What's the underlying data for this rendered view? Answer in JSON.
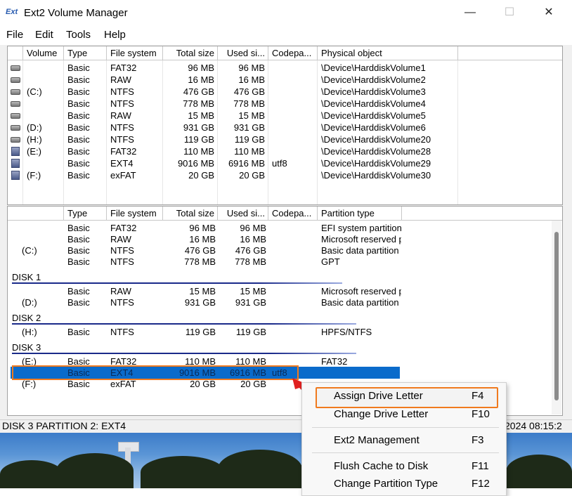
{
  "window": {
    "title": "Ext2 Volume Manager",
    "app_icon_text": "Ext",
    "controls": {
      "minimize": "—",
      "maximize": "☐",
      "close": "✕"
    }
  },
  "menubar": [
    "File",
    "Edit",
    "Tools",
    "Help"
  ],
  "volume_list": {
    "headers": [
      "Volume",
      "Type",
      "File system",
      "Total size",
      "Used si...",
      "Codepa...",
      "Physical object"
    ],
    "rows": [
      {
        "icon": "drive",
        "volume": "",
        "type": "Basic",
        "fs": "FAT32",
        "total": "96 MB",
        "used": "96 MB",
        "codepage": "",
        "physical": "\\Device\\HarddiskVolume1"
      },
      {
        "icon": "drive",
        "volume": "",
        "type": "Basic",
        "fs": "RAW",
        "total": "16 MB",
        "used": "16 MB",
        "codepage": "",
        "physical": "\\Device\\HarddiskVolume2"
      },
      {
        "icon": "drive",
        "volume": "(C:)",
        "type": "Basic",
        "fs": "NTFS",
        "total": "476 GB",
        "used": "476 GB",
        "codepage": "",
        "physical": "\\Device\\HarddiskVolume3"
      },
      {
        "icon": "drive",
        "volume": "",
        "type": "Basic",
        "fs": "NTFS",
        "total": "778 MB",
        "used": "778 MB",
        "codepage": "",
        "physical": "\\Device\\HarddiskVolume4"
      },
      {
        "icon": "drive",
        "volume": "",
        "type": "Basic",
        "fs": "RAW",
        "total": "15 MB",
        "used": "15 MB",
        "codepage": "",
        "physical": "\\Device\\HarddiskVolume5"
      },
      {
        "icon": "drive",
        "volume": "(D:)",
        "type": "Basic",
        "fs": "NTFS",
        "total": "931 GB",
        "used": "931 GB",
        "codepage": "",
        "physical": "\\Device\\HarddiskVolume6"
      },
      {
        "icon": "drive",
        "volume": "(H:)",
        "type": "Basic",
        "fs": "NTFS",
        "total": "119 GB",
        "used": "119 GB",
        "codepage": "",
        "physical": "\\Device\\HarddiskVolume20"
      },
      {
        "icon": "usb",
        "volume": "(E:)",
        "type": "Basic",
        "fs": "FAT32",
        "total": "110 MB",
        "used": "110 MB",
        "codepage": "",
        "physical": "\\Device\\HarddiskVolume28"
      },
      {
        "icon": "usb",
        "volume": "",
        "type": "Basic",
        "fs": "EXT4",
        "total": "9016 MB",
        "used": "6916 MB",
        "codepage": "utf8",
        "physical": "\\Device\\HarddiskVolume29"
      },
      {
        "icon": "usb",
        "volume": "(F:)",
        "type": "Basic",
        "fs": "exFAT",
        "total": "20 GB",
        "used": "20 GB",
        "codepage": "",
        "physical": "\\Device\\HarddiskVolume30"
      }
    ]
  },
  "disk_list": {
    "headers": [
      "",
      "Type",
      "File system",
      "Total size",
      "Used si...",
      "Codepa...",
      "Partition type"
    ],
    "groups": [
      {
        "label": "",
        "rows": [
          {
            "vol": "",
            "type": "Basic",
            "fs": "FAT32",
            "total": "96 MB",
            "used": "96 MB",
            "cp": "",
            "ptype": "EFI system partition"
          },
          {
            "vol": "",
            "type": "Basic",
            "fs": "RAW",
            "total": "16 MB",
            "used": "16 MB",
            "cp": "",
            "ptype": "Microsoft reserved p"
          },
          {
            "vol": "(C:)",
            "type": "Basic",
            "fs": "NTFS",
            "total": "476 GB",
            "used": "476 GB",
            "cp": "",
            "ptype": "Basic data partition"
          },
          {
            "vol": "",
            "type": "Basic",
            "fs": "NTFS",
            "total": "778 MB",
            "used": "778 MB",
            "cp": "",
            "ptype": "GPT"
          }
        ]
      },
      {
        "label": "DISK 1",
        "rows": [
          {
            "vol": "",
            "type": "Basic",
            "fs": "RAW",
            "total": "15 MB",
            "used": "15 MB",
            "cp": "",
            "ptype": "Microsoft reserved p"
          },
          {
            "vol": "(D:)",
            "type": "Basic",
            "fs": "NTFS",
            "total": "931 GB",
            "used": "931 GB",
            "cp": "",
            "ptype": "Basic data partition"
          }
        ]
      },
      {
        "label": "DISK 2",
        "rows": [
          {
            "vol": "(H:)",
            "type": "Basic",
            "fs": "NTFS",
            "total": "119 GB",
            "used": "119 GB",
            "cp": "",
            "ptype": "HPFS/NTFS"
          }
        ]
      },
      {
        "label": "DISK 3",
        "rows": [
          {
            "vol": "(E:)",
            "type": "Basic",
            "fs": "FAT32",
            "total": "110 MB",
            "used": "110 MB",
            "cp": "",
            "ptype": "FAT32"
          },
          {
            "vol": "",
            "type": "Basic",
            "fs": "EXT4",
            "total": "9016 MB",
            "used": "6916 MB",
            "cp": "utf8",
            "ptype": "",
            "selected": true
          },
          {
            "vol": "(F:)",
            "type": "Basic",
            "fs": "exFAT",
            "total": "20 GB",
            "used": "20 GB",
            "cp": "",
            "ptype": ""
          }
        ]
      }
    ]
  },
  "context_menu": {
    "items": [
      {
        "label": "Assign Drive Letter",
        "key": "F4",
        "highlighted": true
      },
      {
        "label": "Change Drive Letter",
        "key": "F10"
      },
      {
        "label": "Ext2 Management",
        "key": "F3"
      },
      {
        "label": "Flush Cache to Disk",
        "key": "F11"
      },
      {
        "label": "Change Partition Type",
        "key": "F12"
      }
    ]
  },
  "statusbar": {
    "text": "DISK 3 PARTITION 2:  EXT4",
    "time": "2024 08:15:2"
  },
  "colors": {
    "selection": "#0a6bcb",
    "highlight_border": "#f07a1e",
    "disk_line": "#1a2a8a"
  }
}
